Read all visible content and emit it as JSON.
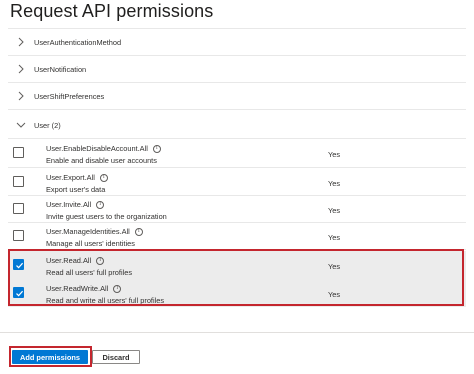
{
  "panel": {
    "title": "Request API permissions"
  },
  "groups": [
    {
      "label": "UserAuthenticationMethod"
    },
    {
      "label": "UserNotification"
    },
    {
      "label": "UserShiftPreferences"
    },
    {
      "label": "User (2)"
    }
  ],
  "permissions": [
    {
      "name": "User.EnableDisableAccount.All",
      "description": "Enable and disable user accounts",
      "admin_consent": "Yes",
      "checked": false
    },
    {
      "name": "User.Export.All",
      "description": "Export user's data",
      "admin_consent": "Yes",
      "checked": false
    },
    {
      "name": "User.Invite.All",
      "description": "Invite guest users to the organization",
      "admin_consent": "Yes",
      "checked": false
    },
    {
      "name": "User.ManageIdentities.All",
      "description": "Manage all users' identities",
      "admin_consent": "Yes",
      "checked": false
    },
    {
      "name": "User.Read.All",
      "description": "Read all users' full profiles",
      "admin_consent": "Yes",
      "checked": true
    },
    {
      "name": "User.ReadWrite.All",
      "description": "Read and write all users' full profiles",
      "admin_consent": "Yes",
      "checked": true
    }
  ],
  "footer": {
    "add_label": "Add permissions",
    "discard_label": "Discard"
  },
  "colors": {
    "accent": "#0078d4",
    "highlight": "#c4262e",
    "selected_row": "#ececec"
  },
  "icons": {
    "collapsed": "chevron-right-icon",
    "expanded": "chevron-down-icon",
    "info": "info-icon",
    "check": "checkmark-icon"
  }
}
